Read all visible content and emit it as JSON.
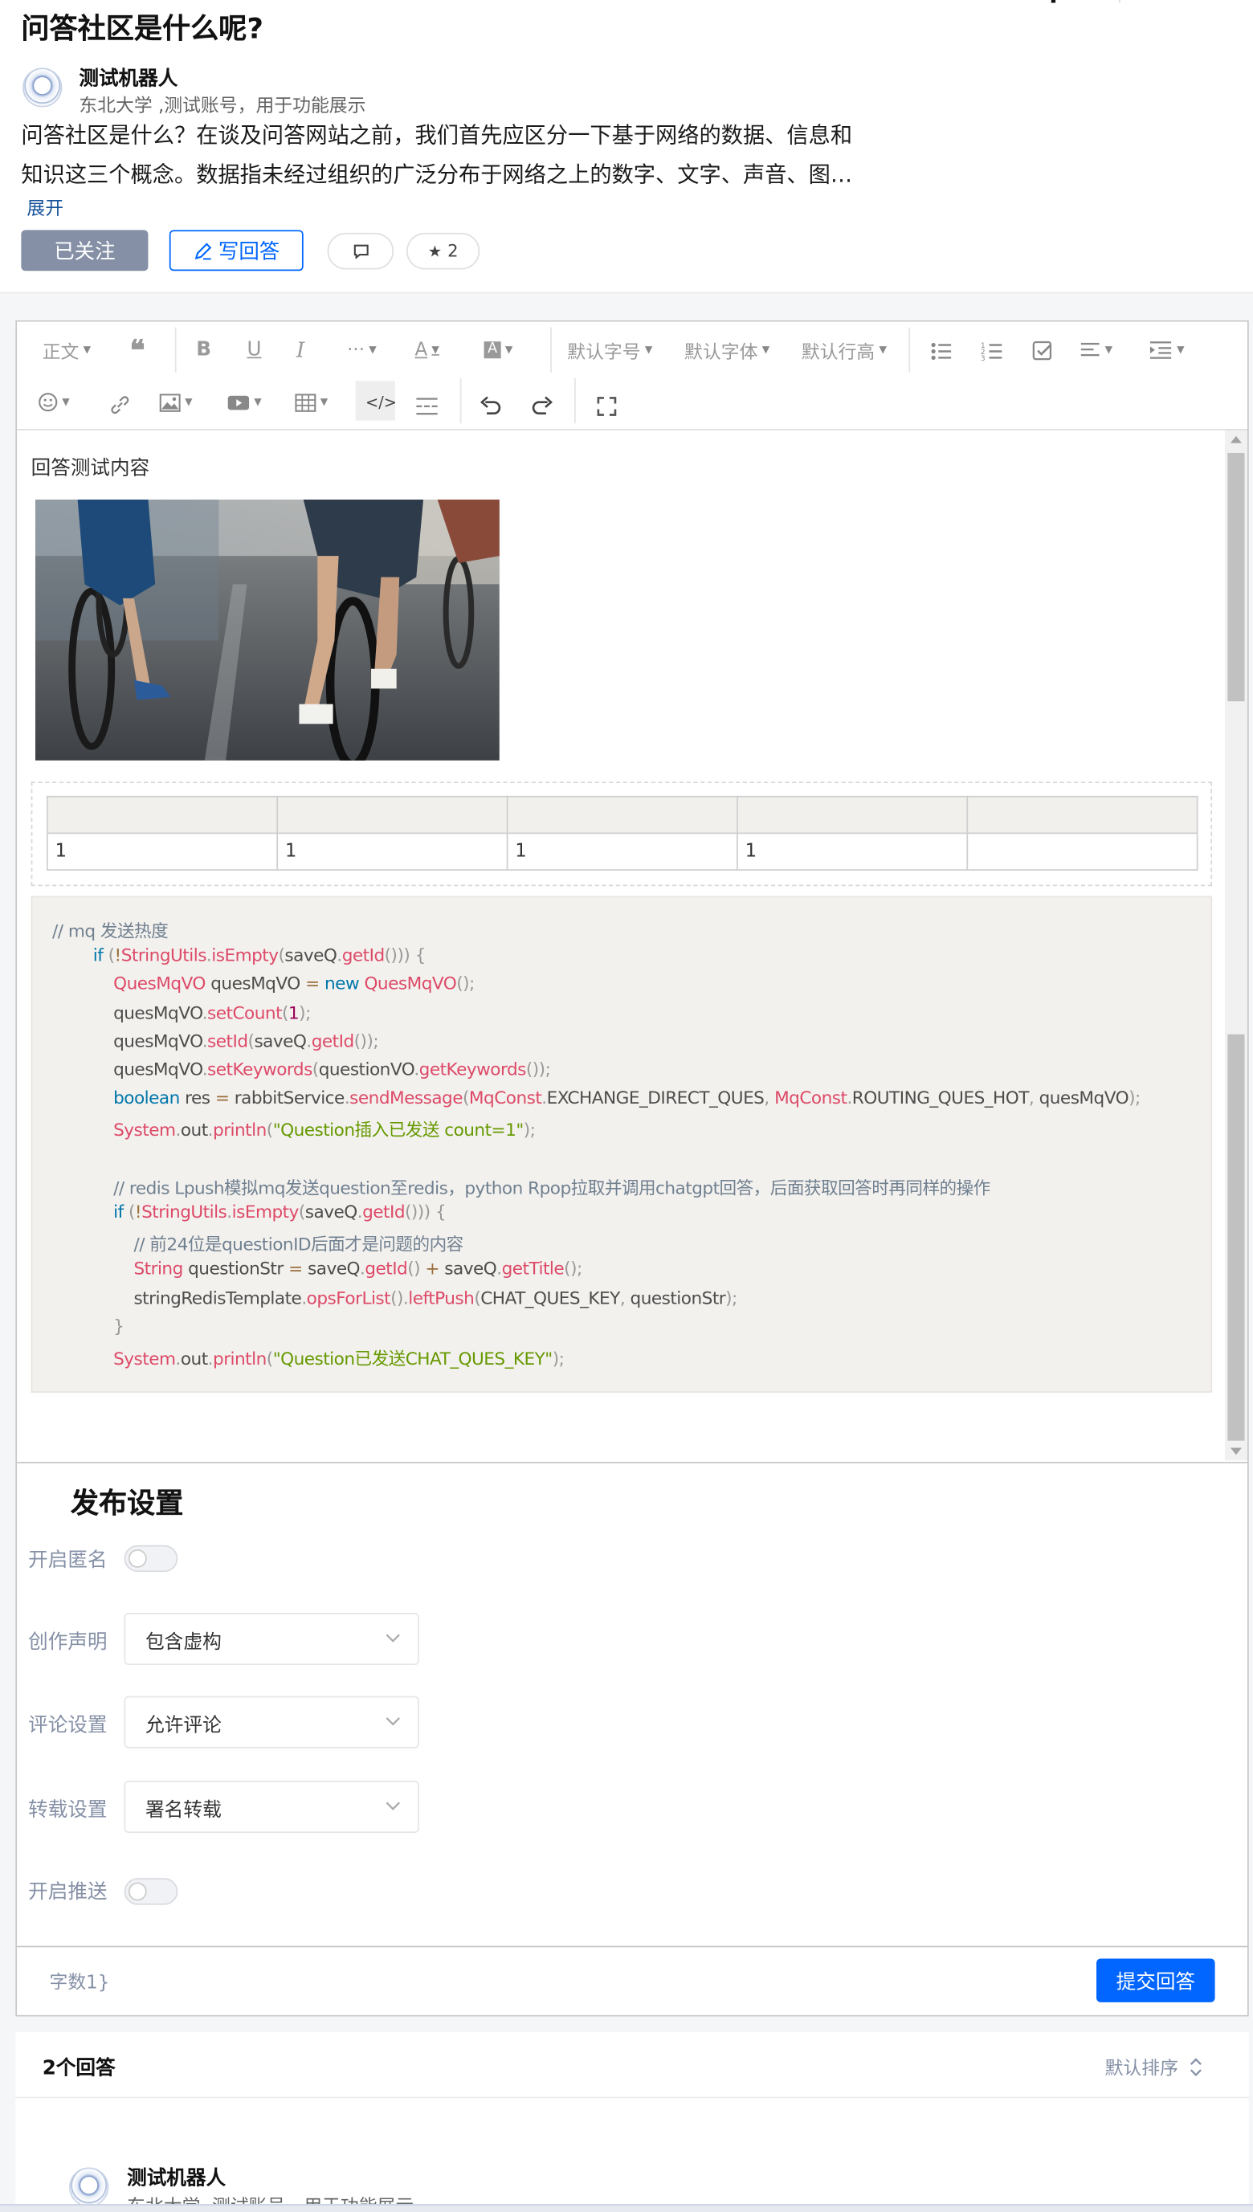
{
  "question": {
    "title": "问答社区是什么呢?",
    "author_name": "测试机器人",
    "author_desc": "东北大学 ,测试账号，用于功能展示",
    "summary_line1": "问答社区是什么？在谈及问答网站之前，我们首先应区分一下基于网络的数据、信息和",
    "summary_line2": "知识这三个概念。数据指未经过组织的广泛分布于网络之上的数字、文字、声音、图…",
    "expand_label": "展开",
    "follow_label": "已关注",
    "write_label": "写回答",
    "star_count": "2"
  },
  "toolbar": {
    "paragraph": "正文",
    "font_size": "默认字号",
    "font_family": "默认字体",
    "line_height": "默认行高"
  },
  "editor": {
    "text": "回答测试内容",
    "table": {
      "header": [
        "",
        "",
        "",
        "",
        ""
      ],
      "row": [
        "1",
        "1",
        "1",
        "1",
        ""
      ]
    }
  },
  "code_lines": [
    [
      [
        "cm",
        "// mq 发送热度"
      ]
    ],
    [
      [
        "",
        "        "
      ],
      [
        "kw",
        "if"
      ],
      [
        "pu",
        " ("
      ],
      [
        "op",
        "!"
      ],
      [
        "fn",
        "StringUtils"
      ],
      [
        "pu",
        "."
      ],
      [
        "fn",
        "isEmpty"
      ],
      [
        "pu",
        "("
      ],
      [
        "",
        "saveQ"
      ],
      [
        "pu",
        "."
      ],
      [
        "fn",
        "getId"
      ],
      [
        "pu",
        "())) {"
      ]
    ],
    [
      [
        "",
        "            "
      ],
      [
        "fn",
        "QuesMqVO"
      ],
      [
        "",
        " quesMqVO "
      ],
      [
        "op",
        "="
      ],
      [
        "",
        " "
      ],
      [
        "kw",
        "new"
      ],
      [
        "",
        " "
      ],
      [
        "fn",
        "QuesMqVO"
      ],
      [
        "pu",
        "();"
      ]
    ],
    [
      [
        "",
        "            quesMqVO"
      ],
      [
        "pu",
        "."
      ],
      [
        "fn",
        "setCount"
      ],
      [
        "pu",
        "("
      ],
      [
        "nm",
        "1"
      ],
      [
        "pu",
        ");"
      ]
    ],
    [
      [
        "",
        "            quesMqVO"
      ],
      [
        "pu",
        "."
      ],
      [
        "fn",
        "setId"
      ],
      [
        "pu",
        "("
      ],
      [
        "",
        "saveQ"
      ],
      [
        "pu",
        "."
      ],
      [
        "fn",
        "getId"
      ],
      [
        "pu",
        "());"
      ]
    ],
    [
      [
        "",
        "            quesMqVO"
      ],
      [
        "pu",
        "."
      ],
      [
        "fn",
        "setKeywords"
      ],
      [
        "pu",
        "("
      ],
      [
        "",
        "questionVO"
      ],
      [
        "pu",
        "."
      ],
      [
        "fn",
        "getKeywords"
      ],
      [
        "pu",
        "());"
      ]
    ],
    [
      [
        "",
        "            "
      ],
      [
        "kw",
        "boolean"
      ],
      [
        "",
        " res "
      ],
      [
        "op",
        "="
      ],
      [
        "",
        " rabbitService"
      ],
      [
        "pu",
        "."
      ],
      [
        "fn",
        "sendMessage"
      ],
      [
        "pu",
        "("
      ],
      [
        "fn",
        "MqConst"
      ],
      [
        "pu",
        "."
      ],
      [
        "",
        "EXCHANGE_DIRECT_QUES"
      ],
      [
        "pu",
        ", "
      ],
      [
        "fn",
        "MqConst"
      ],
      [
        "pu",
        "."
      ],
      [
        "",
        "ROUTING_QUES_HOT"
      ],
      [
        "pu",
        ", "
      ],
      [
        "",
        "quesMqVO"
      ],
      [
        "pu",
        ");"
      ]
    ],
    [
      [
        "",
        "            "
      ],
      [
        "fn",
        "System"
      ],
      [
        "pu",
        "."
      ],
      [
        "",
        "out"
      ],
      [
        "pu",
        "."
      ],
      [
        "fn",
        "println"
      ],
      [
        "pu",
        "("
      ],
      [
        "st",
        "\"Question插入已发送 count=1\""
      ],
      [
        "pu",
        ");"
      ]
    ],
    [],
    [
      [
        "",
        "            "
      ],
      [
        "cm",
        "// redis Lpush模拟mq发送question至redis，python Rpop拉取并调用chatgpt回答，后面获取回答时再同样的操作"
      ]
    ],
    [
      [
        "",
        "            "
      ],
      [
        "kw",
        "if"
      ],
      [
        "pu",
        " ("
      ],
      [
        "op",
        "!"
      ],
      [
        "fn",
        "StringUtils"
      ],
      [
        "pu",
        "."
      ],
      [
        "fn",
        "isEmpty"
      ],
      [
        "pu",
        "("
      ],
      [
        "",
        "saveQ"
      ],
      [
        "pu",
        "."
      ],
      [
        "fn",
        "getId"
      ],
      [
        "pu",
        "())) {"
      ]
    ],
    [
      [
        "",
        "                "
      ],
      [
        "cm",
        "// 前24位是questionID后面才是问题的内容"
      ]
    ],
    [
      [
        "",
        "                "
      ],
      [
        "fn",
        "String"
      ],
      [
        "",
        " questionStr "
      ],
      [
        "op",
        "="
      ],
      [
        "",
        " saveQ"
      ],
      [
        "pu",
        "."
      ],
      [
        "fn",
        "getId"
      ],
      [
        "pu",
        "() "
      ],
      [
        "op",
        "+"
      ],
      [
        "",
        " saveQ"
      ],
      [
        "pu",
        "."
      ],
      [
        "fn",
        "getTitle"
      ],
      [
        "pu",
        "();"
      ]
    ],
    [
      [
        "",
        "                stringRedisTemplate"
      ],
      [
        "pu",
        "."
      ],
      [
        "fn",
        "opsForList"
      ],
      [
        "pu",
        "()."
      ],
      [
        "fn",
        "leftPush"
      ],
      [
        "pu",
        "("
      ],
      [
        "",
        "CHAT_QUES_KEY"
      ],
      [
        "pu",
        ", "
      ],
      [
        "",
        "questionStr"
      ],
      [
        "pu",
        ");"
      ]
    ],
    [
      [
        "",
        "            "
      ],
      [
        "pu",
        "}"
      ]
    ],
    [
      [
        "",
        "            "
      ],
      [
        "fn",
        "System"
      ],
      [
        "pu",
        "."
      ],
      [
        "",
        "out"
      ],
      [
        "pu",
        "."
      ],
      [
        "fn",
        "println"
      ],
      [
        "pu",
        "("
      ],
      [
        "st",
        "\"Question已发送CHAT_QUES_KEY\""
      ],
      [
        "pu",
        ");"
      ]
    ]
  ],
  "publish": {
    "title": "发布设置",
    "anonymous_label": "开启匿名",
    "anonymous_on": false,
    "declaration_label": "创作声明",
    "declaration_value": "包含虚构",
    "comment_label": "评论设置",
    "comment_value": "允许评论",
    "repost_label": "转载设置",
    "repost_value": "署名转载",
    "push_label": "开启推送",
    "push_on": false
  },
  "footer": {
    "word_count": "字数1}",
    "submit_label": "提交回答"
  },
  "answers": {
    "count_label": "2个回答",
    "sort_label": "默认排序",
    "first_author_name": "测试机器人",
    "first_author_desc": "东北大学 ,测试账号，用于功能展示"
  },
  "colors": {
    "primary": "#0066ff",
    "followed_bg": "#8590a6",
    "code_bg": "#f3f1ee"
  }
}
